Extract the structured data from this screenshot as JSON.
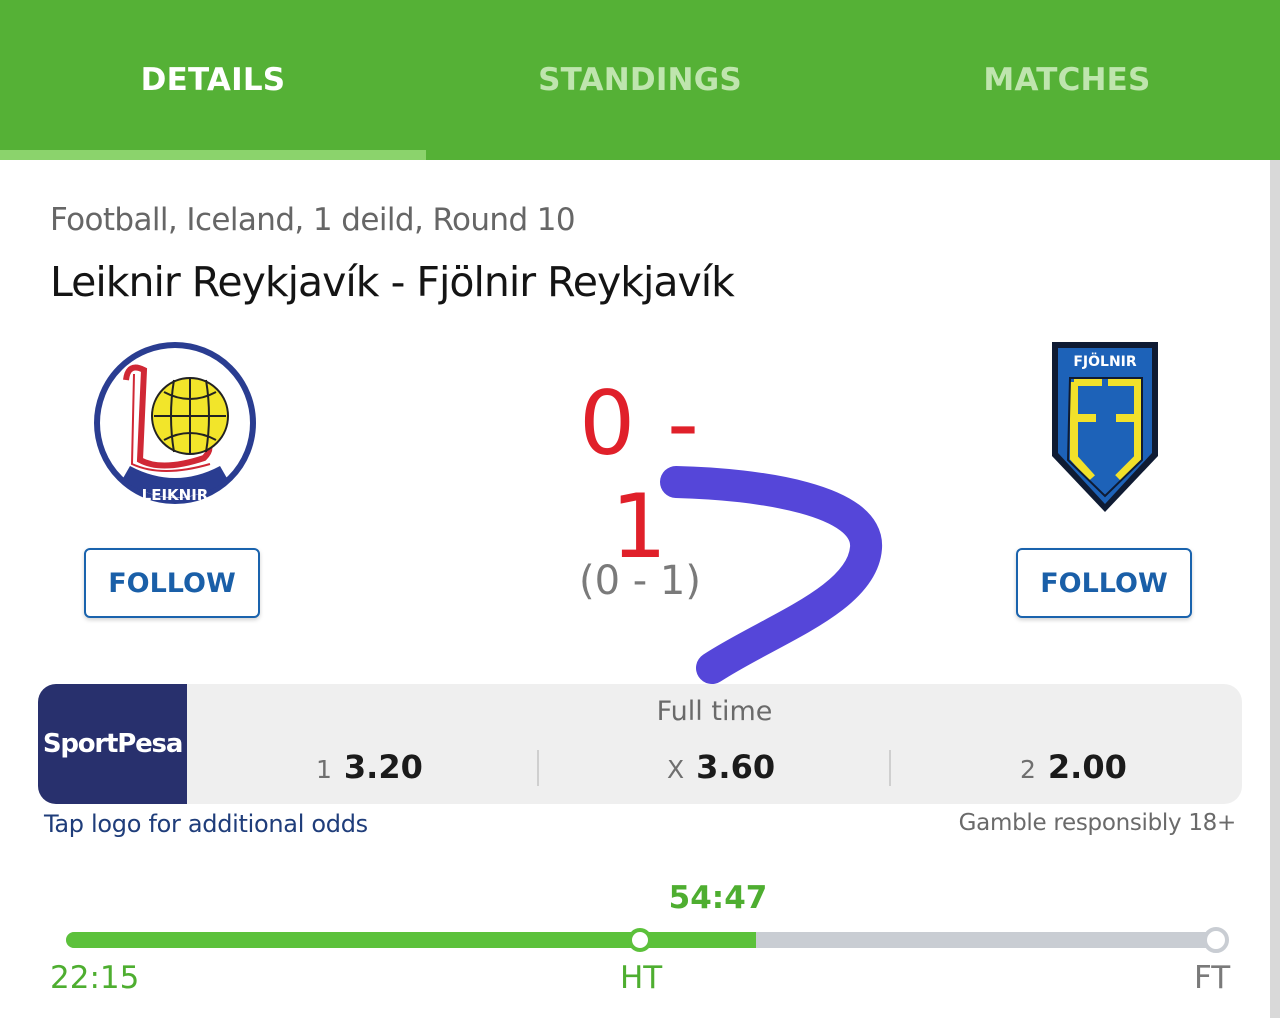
{
  "tabs": [
    {
      "label": "DETAILS",
      "active": true
    },
    {
      "label": "STANDINGS",
      "active": false
    },
    {
      "label": "MATCHES",
      "active": false
    }
  ],
  "match": {
    "breadcrumb": "Football, Iceland, 1 deild, Round 10",
    "title": "Leiknir Reykjavík - Fjölnir Reykjavík",
    "home_logo_text": "LEIKNIR",
    "away_logo_text": "FJÖLNIR",
    "score": "0 - 1",
    "halftime_score": "(0 - 1)",
    "follow_label": "FOLLOW"
  },
  "odds": {
    "sponsor": "SportPesa",
    "header": "Full time",
    "items": [
      {
        "key": "1",
        "value": "3.20"
      },
      {
        "key": "X",
        "value": "3.60"
      },
      {
        "key": "2",
        "value": "2.00"
      }
    ],
    "tap_text": "Tap logo for additional odds",
    "gamble_text": "Gamble responsibly 18+"
  },
  "timeline": {
    "current": "54:47",
    "start": "22:15",
    "ht": "HT",
    "ft": "FT",
    "progress": 0.6
  },
  "colors": {
    "brand_green": "#55b136",
    "score_red": "#e0202a",
    "follow_blue": "#1a63ad",
    "sponsor_navy": "#28306d",
    "scribble": "#5546d9"
  }
}
